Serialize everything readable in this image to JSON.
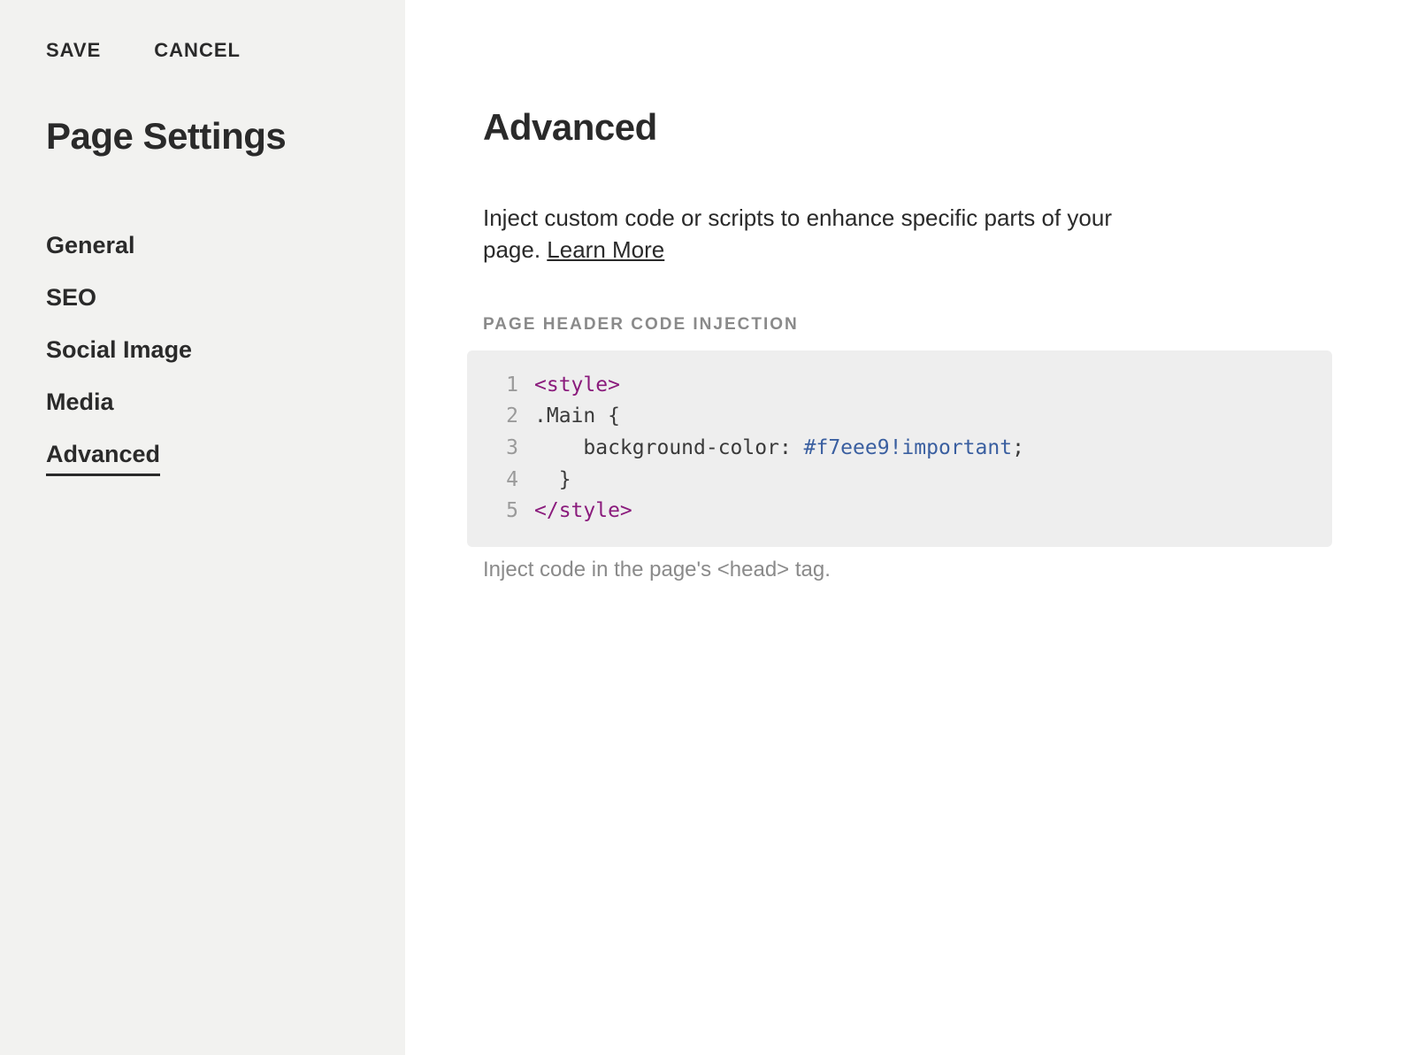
{
  "sidebar": {
    "save_label": "SAVE",
    "cancel_label": "CANCEL",
    "title": "Page Settings",
    "nav": [
      {
        "label": "General",
        "active": false
      },
      {
        "label": "SEO",
        "active": false
      },
      {
        "label": "Social Image",
        "active": false
      },
      {
        "label": "Media",
        "active": false
      },
      {
        "label": "Advanced",
        "active": true
      }
    ]
  },
  "main": {
    "title": "Advanced",
    "description_prefix": "Inject custom code or scripts to enhance specific parts of your page. ",
    "learn_more_label": "Learn More",
    "section_label": "PAGE HEADER CODE INJECTION",
    "help_text": "Inject code in the page's <head> tag.",
    "code_lines": [
      {
        "n": "1",
        "tokens": [
          {
            "cls": "tok-tag",
            "t": "<style>"
          }
        ]
      },
      {
        "n": "2",
        "tokens": [
          {
            "cls": "tok-plain",
            "t": ".Main {"
          }
        ]
      },
      {
        "n": "3",
        "tokens": [
          {
            "cls": "tok-plain",
            "t": "    background-color: "
          },
          {
            "cls": "tok-hex",
            "t": "#f7eee9"
          },
          {
            "cls": "tok-imp",
            "t": "!important"
          },
          {
            "cls": "tok-plain",
            "t": ";"
          }
        ]
      },
      {
        "n": "4",
        "tokens": [
          {
            "cls": "tok-plain",
            "t": "  }"
          }
        ]
      },
      {
        "n": "5",
        "tokens": [
          {
            "cls": "tok-tag",
            "t": "</style>"
          }
        ]
      }
    ]
  }
}
